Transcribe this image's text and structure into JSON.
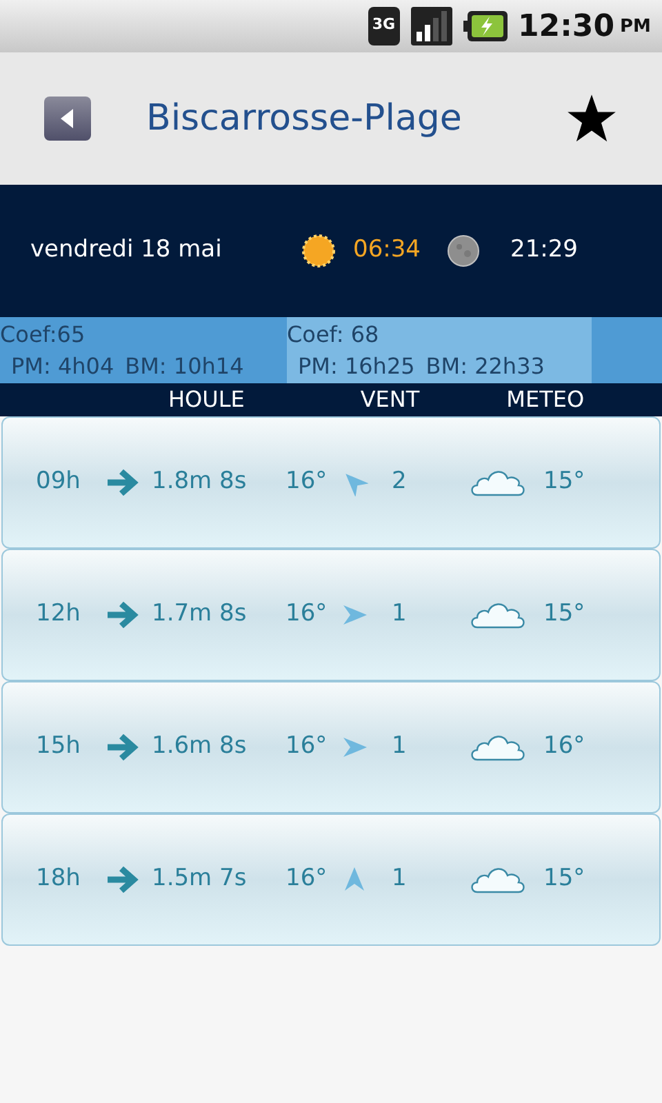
{
  "status_bar": {
    "network": "3G",
    "time": "12:30",
    "meridiem": "PM"
  },
  "header": {
    "title": "Biscarrosse-Plage",
    "favorite": true
  },
  "day": {
    "date": "vendredi 18 mai",
    "sunrise": "06:34",
    "sunset": "21:29"
  },
  "tides": [
    {
      "coef": "Coef:65",
      "pm_label": "PM:",
      "pm": "4h04",
      "bm_label": "BM:",
      "bm": "10h14",
      "selected": false
    },
    {
      "coef": "Coef: 68",
      "pm_label": "PM:",
      "pm": "16h25",
      "bm_label": "BM:",
      "bm": "22h33",
      "selected": true
    }
  ],
  "columns": [
    "HOULE",
    "VENT",
    "METEO"
  ],
  "rows": [
    {
      "time": "09h",
      "swell": "1.8m 8s",
      "water_temp": "16°",
      "kind": "northwest",
      "wind": "2",
      "air_temp": "15°"
    },
    {
      "time": "12h",
      "swell": "1.7m 8s",
      "water_temp": "16°",
      "kind": "east",
      "wind": "1",
      "air_temp": "15°"
    },
    {
      "time": "15h",
      "swell": "1.6m 8s",
      "water_temp": "16°",
      "kind": "east",
      "wind": "1",
      "air_temp": "16°"
    },
    {
      "time": "18h",
      "swell": "1.5m 7s",
      "water_temp": "16°",
      "kind": "north",
      "wind": "1",
      "air_temp": "15°"
    }
  ]
}
